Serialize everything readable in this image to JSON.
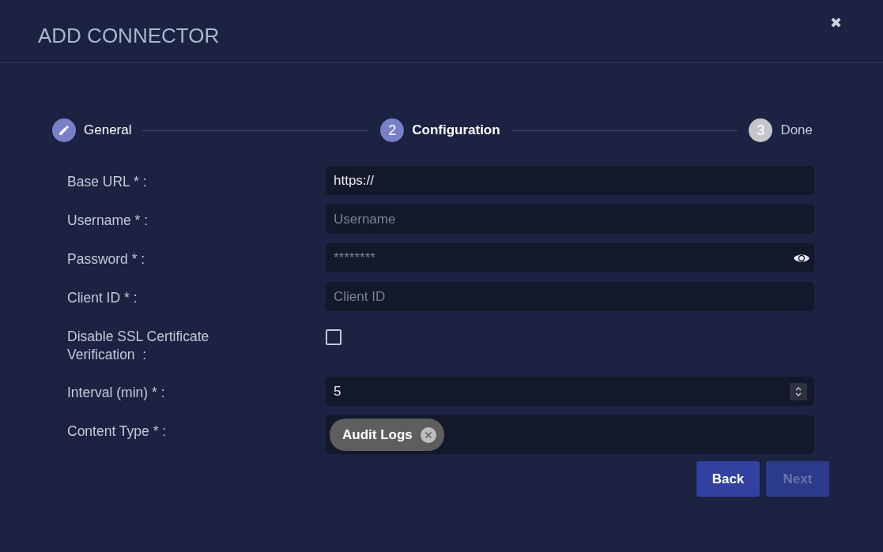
{
  "dialog": {
    "title": "ADD CONNECTOR",
    "close": "✖"
  },
  "steps": [
    {
      "label": "General",
      "completed": true,
      "selected": false
    },
    {
      "label": "Configuration",
      "number": "2",
      "completed": false,
      "selected": true
    },
    {
      "label": "Done",
      "number": "3",
      "completed": false,
      "selected": false
    }
  ],
  "fields": [
    {
      "kind": "text",
      "label": "Base URL * :",
      "value": "https://"
    },
    {
      "kind": "text",
      "label": "Username * :",
      "placeholder": "Username"
    },
    {
      "kind": "password",
      "label": "Password * :",
      "placeholder": "********"
    },
    {
      "kind": "text",
      "label": "Client ID * :",
      "placeholder": "Client ID"
    },
    {
      "kind": "checkbox",
      "label": "Disable SSL Certificate Verification  :",
      "checked": false
    },
    {
      "kind": "number",
      "label": "Interval (min) * :",
      "value": "5"
    },
    {
      "kind": "chips",
      "label": "Content Type * :",
      "chips": [
        "Audit Logs"
      ]
    }
  ],
  "buttons": [
    {
      "label": "Back",
      "disabled": false
    },
    {
      "label": "Next",
      "disabled": true
    }
  ]
}
